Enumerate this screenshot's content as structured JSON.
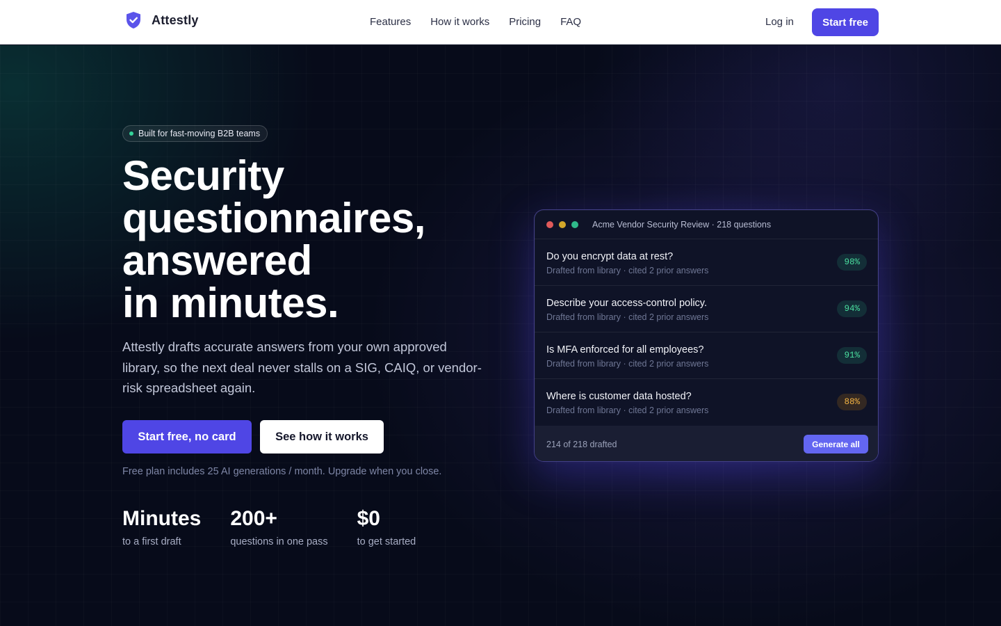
{
  "header": {
    "brand": "Attestly",
    "nav": [
      "Features",
      "How it works",
      "Pricing",
      "FAQ"
    ],
    "login": "Log in",
    "cta": "Start free"
  },
  "hero": {
    "badge": "Built for fast-moving B2B teams",
    "headline_lines": [
      "Security",
      "questionnaires,",
      "answered",
      "in minutes."
    ],
    "subcopy": "Attestly drafts accurate answers from your own approved library, so the next deal never stalls on a SIG, CAIQ, or vendor-risk spreadsheet again.",
    "cta_primary": "Start free, no card",
    "cta_secondary": "See how it works",
    "fineprint": "Free plan includes 25 AI generations / month. Upgrade when you close.",
    "stats": [
      {
        "value": "Minutes",
        "label": "to a first draft"
      },
      {
        "value": "200+",
        "label": "questions in one pass"
      },
      {
        "value": "$0",
        "label": "to get started"
      }
    ]
  },
  "card": {
    "title": "Acme Vendor Security Review · 218 questions",
    "rows": [
      {
        "question": "Do you encrypt data at rest?",
        "meta": "Drafted from library · cited 2 prior answers",
        "score": "98%",
        "status": "green"
      },
      {
        "question": "Describe your access-control policy.",
        "meta": "Drafted from library · cited 2 prior answers",
        "score": "94%",
        "status": "green"
      },
      {
        "question": "Is MFA enforced for all employees?",
        "meta": "Drafted from library · cited 2 prior answers",
        "score": "91%",
        "status": "green"
      },
      {
        "question": "Where is customer data hosted?",
        "meta": "Drafted from library · cited 2 prior answers",
        "score": "88%",
        "status": "amber"
      }
    ],
    "footer_text": "214 of 218 drafted",
    "footer_button": "Generate all"
  },
  "colors": {
    "accent": "#4f46e5",
    "score_green": "#4ade9f",
    "score_amber": "#f5b544"
  }
}
